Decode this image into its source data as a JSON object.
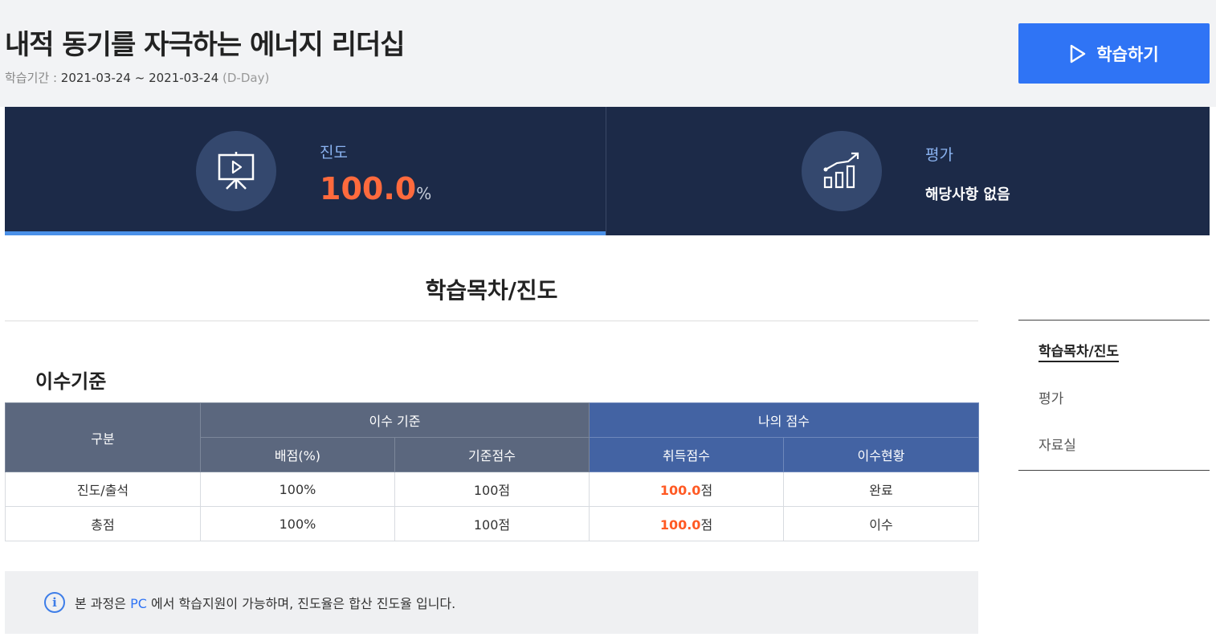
{
  "course": {
    "title": "내적 동기를 자극하는 에너지 리더십",
    "period_label": "학습기간 : ",
    "period_dates": "2021-03-24 ~ 2021-03-24",
    "dday": "(D-Day)"
  },
  "start_button": {
    "label": "학습하기",
    "icon": "play-icon"
  },
  "stats": {
    "progress": {
      "label": "진도",
      "value": "100.0",
      "unit": "%",
      "icon": "presentation-icon",
      "fraction": 1.0
    },
    "evaluation": {
      "label": "평가",
      "value": "해당사항 없음",
      "icon": "growth-chart-icon"
    }
  },
  "colors": {
    "accent": "#2f74f5",
    "stats_bg": "#1c2a48",
    "highlight": "#ff6a3d"
  },
  "section": {
    "title": "학습목차/진도",
    "criteria_title": "이수기준"
  },
  "criteria_table": {
    "headers": {
      "category": "구분",
      "criteria_group": "이수 기준",
      "my_score_group": "나의 점수",
      "weight": "배점(%)",
      "base_score": "기준점수",
      "earned": "취득점수",
      "status": "이수현황"
    },
    "rows": [
      {
        "category": "진도/출석",
        "weight": "100%",
        "base_score": "100점",
        "earned_value": "100.0",
        "earned_unit": "점",
        "status": "완료"
      },
      {
        "category": "총점",
        "weight": "100%",
        "base_score": "100점",
        "earned_value": "100.0",
        "earned_unit": "점",
        "status": "이수"
      }
    ]
  },
  "notice": {
    "icon": "info-icon",
    "prefix": "본 과정은 ",
    "highlight": "PC",
    "suffix": " 에서 학습지원이 가능하며, 진도율은 합산 진도율 입니다."
  },
  "side_nav": {
    "items": [
      {
        "label": "학습목차/진도",
        "active": true
      },
      {
        "label": "평가",
        "active": false
      },
      {
        "label": "자료실",
        "active": false
      }
    ]
  }
}
